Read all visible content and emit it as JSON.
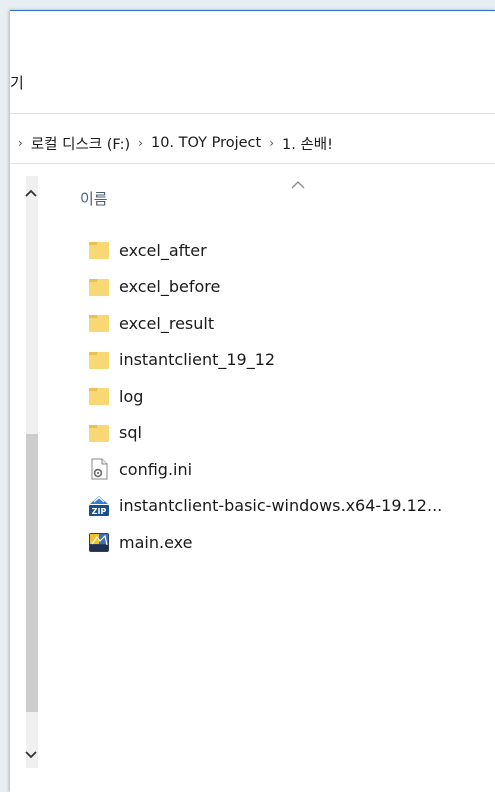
{
  "window": {
    "ribbon_tab_label": "기"
  },
  "address": {
    "crumbs": [
      "로컬 디스크 (F:)",
      "10. TOY Project",
      "1. 손배!"
    ]
  },
  "columns": {
    "name": "이름"
  },
  "files": [
    {
      "name": "excel_after",
      "icon": "folder-icon"
    },
    {
      "name": "excel_before",
      "icon": "folder-icon"
    },
    {
      "name": "excel_result",
      "icon": "folder-icon"
    },
    {
      "name": "instantclient_19_12",
      "icon": "folder-icon"
    },
    {
      "name": "log",
      "icon": "folder-icon"
    },
    {
      "name": "sql",
      "icon": "folder-icon"
    },
    {
      "name": "config.ini",
      "icon": "config-file-icon"
    },
    {
      "name": "instantclient-basic-windows.x64-19.12...",
      "icon": "zip-file-icon"
    },
    {
      "name": "main.exe",
      "icon": "exe-file-icon"
    }
  ],
  "colors": {
    "accent": "#2b73c8",
    "folder": "#f8d775",
    "header_text": "#4c607a"
  }
}
